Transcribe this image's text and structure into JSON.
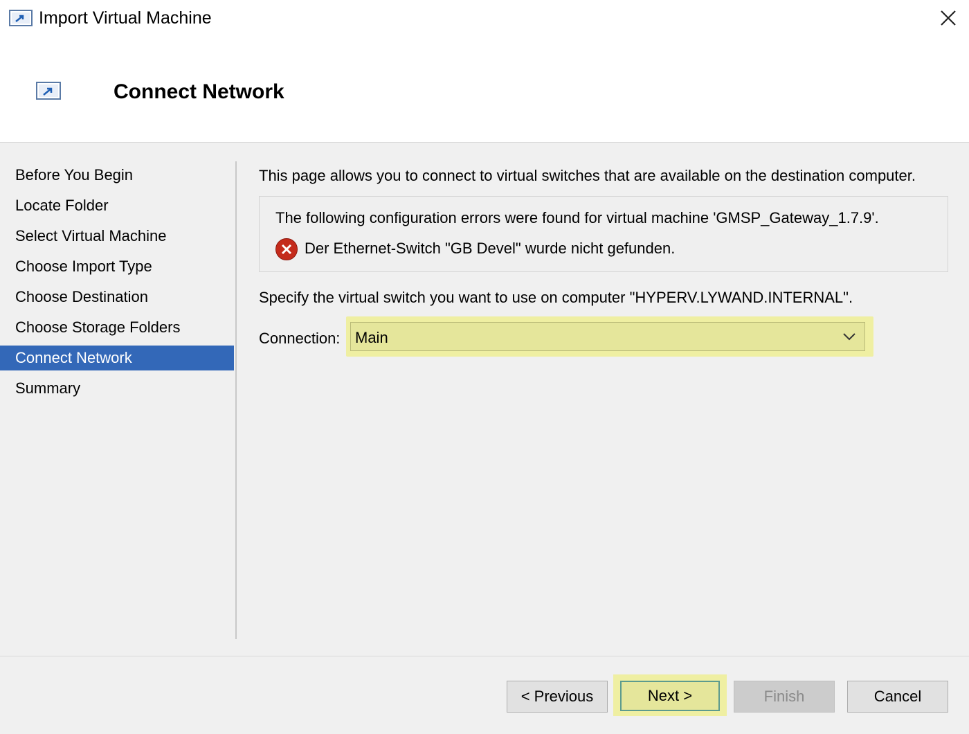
{
  "window": {
    "title": "Import Virtual Machine"
  },
  "header": {
    "title": "Connect Network"
  },
  "nav": {
    "items": [
      {
        "label": "Before You Begin"
      },
      {
        "label": "Locate Folder"
      },
      {
        "label": "Select Virtual Machine"
      },
      {
        "label": "Choose Import Type"
      },
      {
        "label": "Choose Destination"
      },
      {
        "label": "Choose Storage Folders"
      },
      {
        "label": "Connect Network"
      },
      {
        "label": "Summary"
      }
    ],
    "active_item": "Connect Network"
  },
  "content": {
    "intro": "This page allows you to connect to virtual switches that are available on the destination computer.",
    "error_heading": "The following configuration errors were found for virtual machine 'GMSP_Gateway_1.7.9'.",
    "error_message": "Der Ethernet-Switch \"GB Devel\" wurde nicht gefunden.",
    "specify_text": "Specify the virtual switch you want to use on computer \"HYPERV.LYWAND.INTERNAL\".",
    "connection_label": "Connection:",
    "connection_value": "Main"
  },
  "footer": {
    "previous_label": "< Previous",
    "next_label": "Next >",
    "finish_label": "Finish",
    "cancel_label": "Cancel"
  },
  "colors": {
    "accent": "#3368b8",
    "highlight": "#e5e69b",
    "error": "#c42b1c"
  },
  "icons": {
    "app": "import-vm-icon",
    "close": "close-icon",
    "error": "error-icon",
    "dropdown": "chevron-down-icon"
  }
}
